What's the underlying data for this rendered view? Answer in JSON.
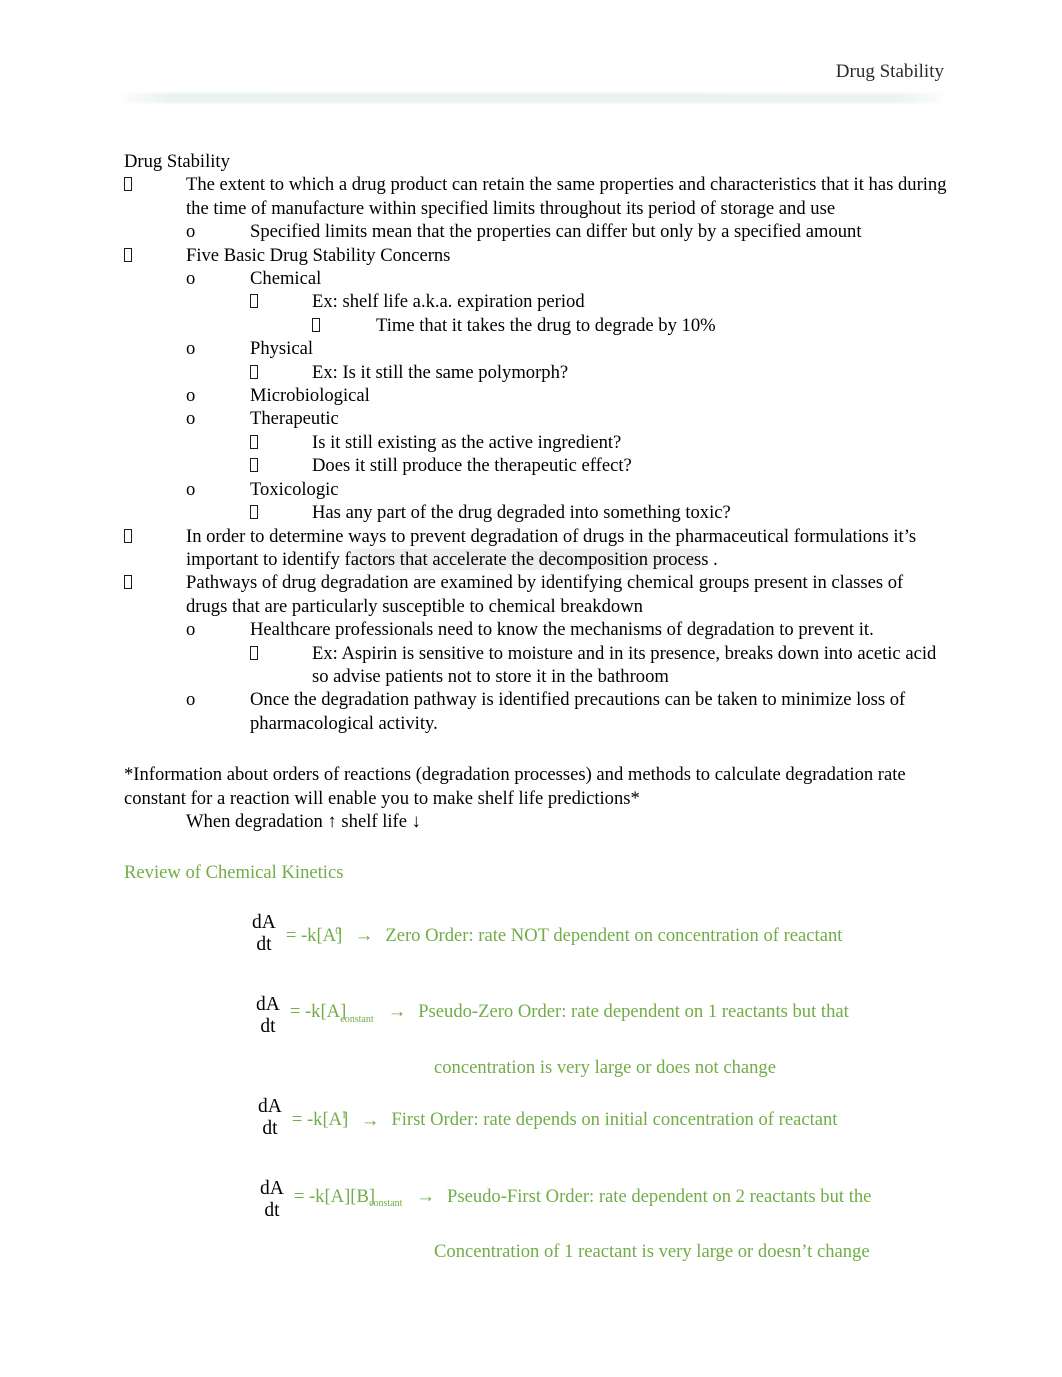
{
  "document": {
    "header_title": "Drug Stability",
    "title": "Drug Stability"
  },
  "outline": [
    {
      "level": 1,
      "marker": "tofu",
      "text": "The extent to which a drug product can retain the same properties and characteristics that it has during the time of manufacture within specified  limits throughout its period of storage and use"
    },
    {
      "level": 2,
      "marker": "o",
      "text": "Specified limits mean that the properties can differ but only by a specified amount"
    },
    {
      "level": 1,
      "marker": "tofu",
      "text": "Five Basic Drug Stability Concerns"
    },
    {
      "level": 2,
      "marker": "o",
      "text": "Chemical"
    },
    {
      "level": 3,
      "marker": "tofu",
      "text": "Ex: shelf life a.k.a. expiration period"
    },
    {
      "level": 4,
      "marker": "tofu",
      "text": "Time that it takes the drug to degrade by 10%"
    },
    {
      "level": 2,
      "marker": "o",
      "text": "Physical"
    },
    {
      "level": 3,
      "marker": "tofu",
      "text": "Ex: Is it still the same polymorph?"
    },
    {
      "level": 2,
      "marker": "o",
      "text": "Microbiological"
    },
    {
      "level": 2,
      "marker": "o",
      "text": "Therapeutic"
    },
    {
      "level": 3,
      "marker": "tofu",
      "text": "Is it still existing as the active ingredient?"
    },
    {
      "level": 3,
      "marker": "tofu",
      "text": "Does it still produce the therapeutic effect?"
    },
    {
      "level": 2,
      "marker": "o",
      "text": "Toxicologic"
    },
    {
      "level": 3,
      "marker": "tofu",
      "text": "Has any part of the drug degraded into something toxic?"
    },
    {
      "level": 1,
      "marker": "tofu",
      "text_plain": "In order to determine ways to prevent degradation of drugs in the pharmaceutical formulations it’s important to identify ",
      "text_shaded": "factors that accelerate the decomposition process",
      "text_tail": "  ."
    },
    {
      "level": 1,
      "marker": "tofu",
      "text": "Pathways of drug degradation are examined by identifying chemical groups present in classes of drugs that are particularly susceptible to chemical breakdown"
    },
    {
      "level": 2,
      "marker": "o",
      "text": "Healthcare professionals need to know the mechanisms of degradation to prevent it."
    },
    {
      "level": 3,
      "marker": "tofu",
      "text": "Ex: Aspirin is sensitive to moisture and in its presence, breaks down into acetic acid so advise patients not to store it in the bathroom"
    },
    {
      "level": 2,
      "marker": "o",
      "text": "Once the degradation pathway is identified precautions can be taken to minimize loss of pharmacological activity."
    }
  ],
  "note": {
    "paragraph": "*Information about orders of reactions (degradation processes) and methods to calculate degradation rate constant for a reaction will enable you to make shelf life predictions*",
    "when_line": "When degradation ↑    shelf life ↓"
  },
  "kinetics": {
    "heading": "Review of Chemical Kinetics",
    "heading_color": "#70AD47",
    "equations": [
      {
        "numerator": "dA",
        "denominator": "dt",
        "equals": "= -k[A]",
        "exponent": "0",
        "exponent_kind": "sup",
        "arrow": "→",
        "description": "Zero Order: rate NOT dependent on concentration of reactant",
        "continuation": ""
      },
      {
        "numerator": "dA",
        "denominator": "dt",
        "equals": "= -k[A]",
        "exponent": "constant",
        "exponent_kind": "sub",
        "arrow": "→",
        "description": "Pseudo-Zero Order: rate dependent on 1 reactants but that",
        "continuation": "concentration is very large or does not change"
      },
      {
        "numerator": "dA",
        "denominator": "dt",
        "equals": "= -k[A]",
        "exponent": "1",
        "exponent_kind": "sup",
        "arrow": "→",
        "description": "First Order: rate depends on initial concentration of reactant",
        "continuation": ""
      },
      {
        "numerator": "dA",
        "denominator": "dt",
        "equals": "= -k[A][B]",
        "exponent": "constant",
        "exponent_kind": "sub",
        "arrow": "→",
        "description": "Pseudo-First Order: rate dependent on 2 reactants but the",
        "continuation": "Concentration of 1 reactant is very large or doesn’t change"
      }
    ]
  }
}
